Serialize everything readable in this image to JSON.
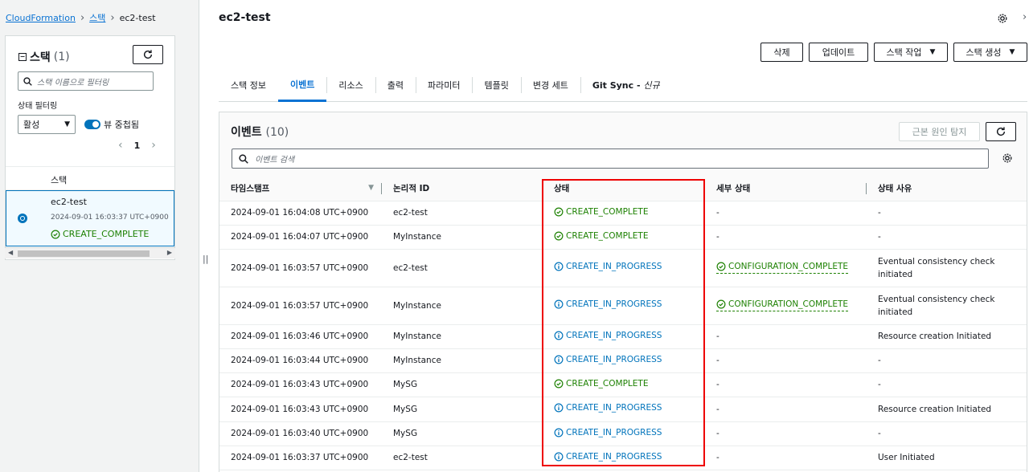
{
  "breadcrumb": {
    "root": "CloudFormation",
    "stacks": "스택",
    "current": "ec2-test"
  },
  "sidebar": {
    "title": "스택",
    "count": "(1)",
    "search_placeholder": "스택 이름으로 필터링",
    "filter_label": "상태 필터링",
    "filter_value": "활성",
    "toggle_label": "뷰 중첩됨",
    "page": "1",
    "column": "스택",
    "stack": {
      "name": "ec2-test",
      "date": "2024-09-01 16:03:37 UTC+0900",
      "status": "CREATE_COMPLETE"
    }
  },
  "main": {
    "title": "ec2-test",
    "actions": {
      "delete": "삭제",
      "update": "업데이트",
      "stack_actions": "스택 작업",
      "create_stack": "스택 생성"
    },
    "tabs": [
      "스택 정보",
      "이벤트",
      "리소스",
      "출력",
      "파라미터",
      "템플릿",
      "변경 세트",
      "Git Sync - "
    ],
    "tab_new_label": "신규",
    "events": {
      "title": "이벤트",
      "count": "(10)",
      "rca_button": "근본 원인 탐지",
      "search_placeholder": "이벤트 검색",
      "columns": [
        "타임스탬프",
        "논리적 ID",
        "상태",
        "세부 상태",
        "상태 사유"
      ],
      "rows": [
        {
          "time": "2024-09-01 16:04:08 UTC+0900",
          "id": "ec2-test",
          "status": "CREATE_COMPLETE",
          "detail": "-",
          "reason": "-"
        },
        {
          "time": "2024-09-01 16:04:07 UTC+0900",
          "id": "MyInstance",
          "status": "CREATE_COMPLETE",
          "detail": "-",
          "reason": "-"
        },
        {
          "time": "2024-09-01 16:03:57 UTC+0900",
          "id": "ec2-test",
          "status": "CREATE_IN_PROGRESS",
          "detail": "CONFIGURATION_COMPLETE",
          "reason": "Eventual consistency check initiated"
        },
        {
          "time": "2024-09-01 16:03:57 UTC+0900",
          "id": "MyInstance",
          "status": "CREATE_IN_PROGRESS",
          "detail": "CONFIGURATION_COMPLETE",
          "reason": "Eventual consistency check initiated"
        },
        {
          "time": "2024-09-01 16:03:46 UTC+0900",
          "id": "MyInstance",
          "status": "CREATE_IN_PROGRESS",
          "detail": "-",
          "reason": "Resource creation Initiated"
        },
        {
          "time": "2024-09-01 16:03:44 UTC+0900",
          "id": "MyInstance",
          "status": "CREATE_IN_PROGRESS",
          "detail": "-",
          "reason": "-"
        },
        {
          "time": "2024-09-01 16:03:43 UTC+0900",
          "id": "MySG",
          "status": "CREATE_COMPLETE",
          "detail": "-",
          "reason": "-"
        },
        {
          "time": "2024-09-01 16:03:43 UTC+0900",
          "id": "MySG",
          "status": "CREATE_IN_PROGRESS",
          "detail": "-",
          "reason": "Resource creation Initiated"
        },
        {
          "time": "2024-09-01 16:03:40 UTC+0900",
          "id": "MySG",
          "status": "CREATE_IN_PROGRESS",
          "detail": "-",
          "reason": "-"
        },
        {
          "time": "2024-09-01 16:03:37 UTC+0900",
          "id": "ec2-test",
          "status": "CREATE_IN_PROGRESS",
          "detail": "-",
          "reason": "User Initiated"
        }
      ]
    }
  },
  "colors": {
    "complete": "#1d8102",
    "progress": "#0073bb",
    "link": "#0972d3",
    "highlight_box": "#ee0000"
  }
}
